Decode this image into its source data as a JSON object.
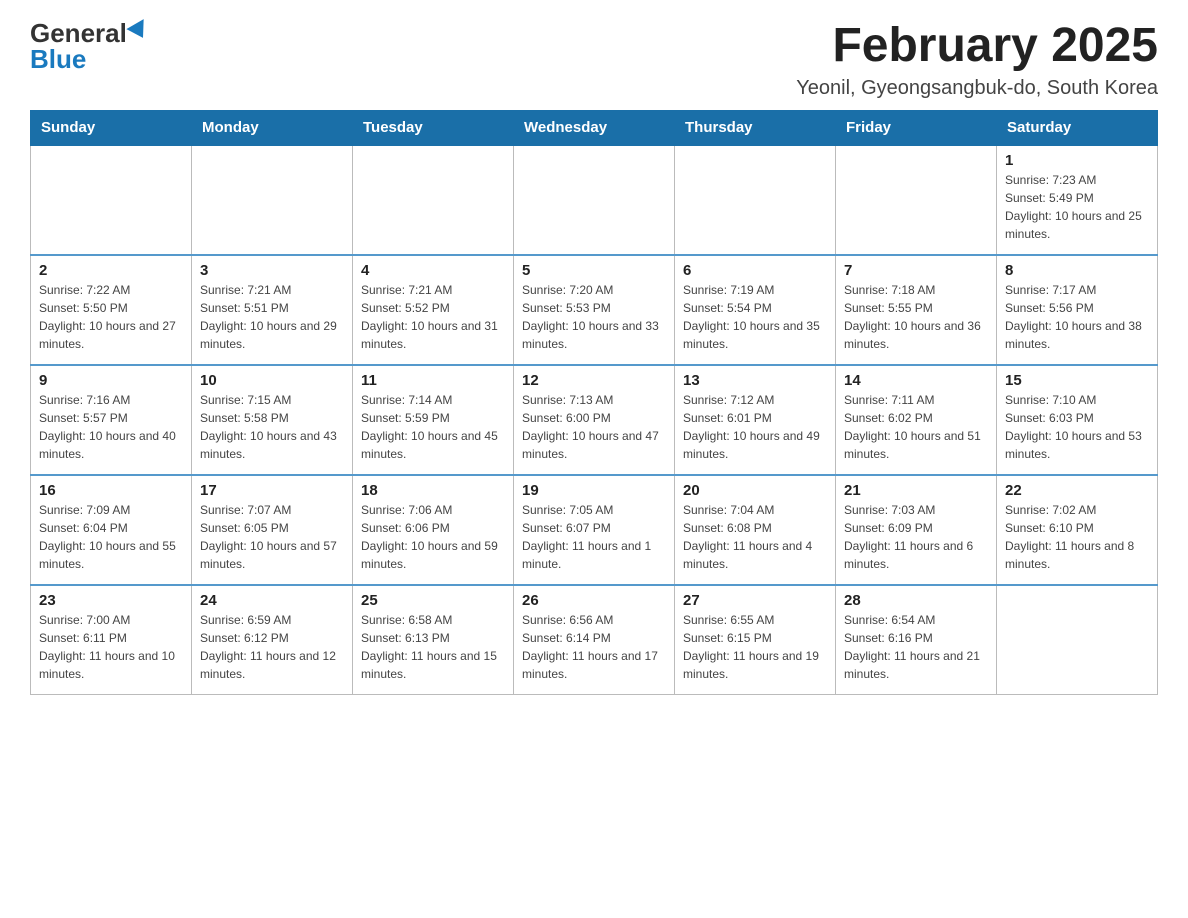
{
  "header": {
    "logo_general": "General",
    "logo_blue": "Blue",
    "month_title": "February 2025",
    "location": "Yeonil, Gyeongsangbuk-do, South Korea"
  },
  "days_of_week": [
    "Sunday",
    "Monday",
    "Tuesday",
    "Wednesday",
    "Thursday",
    "Friday",
    "Saturday"
  ],
  "weeks": [
    [
      {
        "day": "",
        "info": ""
      },
      {
        "day": "",
        "info": ""
      },
      {
        "day": "",
        "info": ""
      },
      {
        "day": "",
        "info": ""
      },
      {
        "day": "",
        "info": ""
      },
      {
        "day": "",
        "info": ""
      },
      {
        "day": "1",
        "info": "Sunrise: 7:23 AM\nSunset: 5:49 PM\nDaylight: 10 hours and 25 minutes."
      }
    ],
    [
      {
        "day": "2",
        "info": "Sunrise: 7:22 AM\nSunset: 5:50 PM\nDaylight: 10 hours and 27 minutes."
      },
      {
        "day": "3",
        "info": "Sunrise: 7:21 AM\nSunset: 5:51 PM\nDaylight: 10 hours and 29 minutes."
      },
      {
        "day": "4",
        "info": "Sunrise: 7:21 AM\nSunset: 5:52 PM\nDaylight: 10 hours and 31 minutes."
      },
      {
        "day": "5",
        "info": "Sunrise: 7:20 AM\nSunset: 5:53 PM\nDaylight: 10 hours and 33 minutes."
      },
      {
        "day": "6",
        "info": "Sunrise: 7:19 AM\nSunset: 5:54 PM\nDaylight: 10 hours and 35 minutes."
      },
      {
        "day": "7",
        "info": "Sunrise: 7:18 AM\nSunset: 5:55 PM\nDaylight: 10 hours and 36 minutes."
      },
      {
        "day": "8",
        "info": "Sunrise: 7:17 AM\nSunset: 5:56 PM\nDaylight: 10 hours and 38 minutes."
      }
    ],
    [
      {
        "day": "9",
        "info": "Sunrise: 7:16 AM\nSunset: 5:57 PM\nDaylight: 10 hours and 40 minutes."
      },
      {
        "day": "10",
        "info": "Sunrise: 7:15 AM\nSunset: 5:58 PM\nDaylight: 10 hours and 43 minutes."
      },
      {
        "day": "11",
        "info": "Sunrise: 7:14 AM\nSunset: 5:59 PM\nDaylight: 10 hours and 45 minutes."
      },
      {
        "day": "12",
        "info": "Sunrise: 7:13 AM\nSunset: 6:00 PM\nDaylight: 10 hours and 47 minutes."
      },
      {
        "day": "13",
        "info": "Sunrise: 7:12 AM\nSunset: 6:01 PM\nDaylight: 10 hours and 49 minutes."
      },
      {
        "day": "14",
        "info": "Sunrise: 7:11 AM\nSunset: 6:02 PM\nDaylight: 10 hours and 51 minutes."
      },
      {
        "day": "15",
        "info": "Sunrise: 7:10 AM\nSunset: 6:03 PM\nDaylight: 10 hours and 53 minutes."
      }
    ],
    [
      {
        "day": "16",
        "info": "Sunrise: 7:09 AM\nSunset: 6:04 PM\nDaylight: 10 hours and 55 minutes."
      },
      {
        "day": "17",
        "info": "Sunrise: 7:07 AM\nSunset: 6:05 PM\nDaylight: 10 hours and 57 minutes."
      },
      {
        "day": "18",
        "info": "Sunrise: 7:06 AM\nSunset: 6:06 PM\nDaylight: 10 hours and 59 minutes."
      },
      {
        "day": "19",
        "info": "Sunrise: 7:05 AM\nSunset: 6:07 PM\nDaylight: 11 hours and 1 minute."
      },
      {
        "day": "20",
        "info": "Sunrise: 7:04 AM\nSunset: 6:08 PM\nDaylight: 11 hours and 4 minutes."
      },
      {
        "day": "21",
        "info": "Sunrise: 7:03 AM\nSunset: 6:09 PM\nDaylight: 11 hours and 6 minutes."
      },
      {
        "day": "22",
        "info": "Sunrise: 7:02 AM\nSunset: 6:10 PM\nDaylight: 11 hours and 8 minutes."
      }
    ],
    [
      {
        "day": "23",
        "info": "Sunrise: 7:00 AM\nSunset: 6:11 PM\nDaylight: 11 hours and 10 minutes."
      },
      {
        "day": "24",
        "info": "Sunrise: 6:59 AM\nSunset: 6:12 PM\nDaylight: 11 hours and 12 minutes."
      },
      {
        "day": "25",
        "info": "Sunrise: 6:58 AM\nSunset: 6:13 PM\nDaylight: 11 hours and 15 minutes."
      },
      {
        "day": "26",
        "info": "Sunrise: 6:56 AM\nSunset: 6:14 PM\nDaylight: 11 hours and 17 minutes."
      },
      {
        "day": "27",
        "info": "Sunrise: 6:55 AM\nSunset: 6:15 PM\nDaylight: 11 hours and 19 minutes."
      },
      {
        "day": "28",
        "info": "Sunrise: 6:54 AM\nSunset: 6:16 PM\nDaylight: 11 hours and 21 minutes."
      },
      {
        "day": "",
        "info": ""
      }
    ]
  ]
}
